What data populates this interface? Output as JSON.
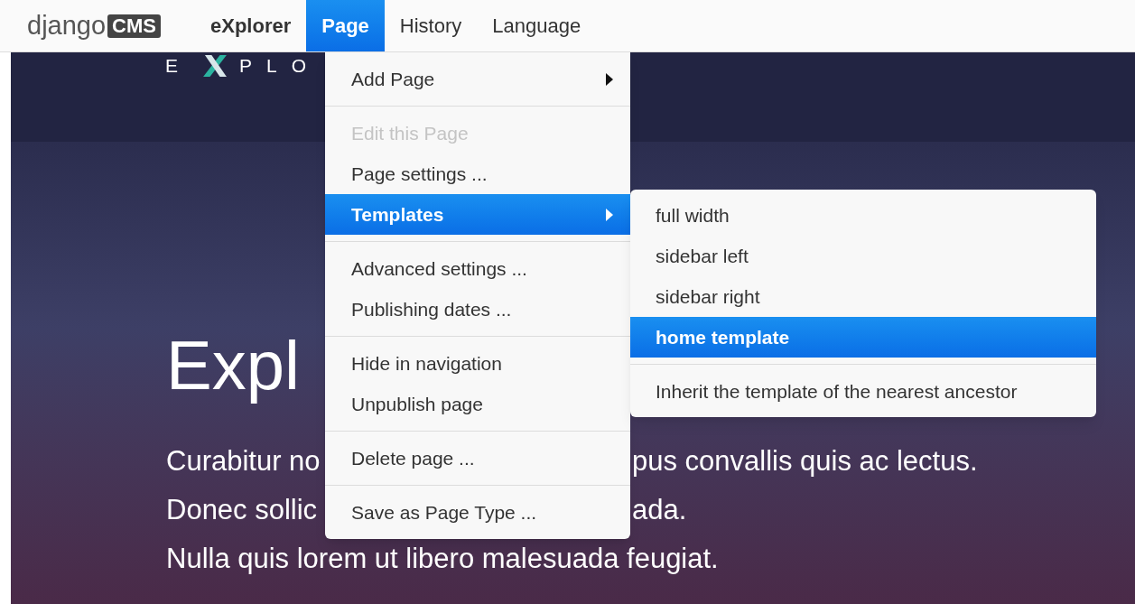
{
  "toolbar": {
    "logo": {
      "word": "django",
      "badge": "CMS"
    },
    "menus": [
      {
        "label": "eXplorer",
        "kind": "site",
        "selected": false
      },
      {
        "label": "Page",
        "kind": "menu",
        "selected": true
      },
      {
        "label": "History",
        "kind": "menu",
        "selected": false
      },
      {
        "label": "Language",
        "kind": "menu",
        "selected": false
      }
    ]
  },
  "hero": {
    "logo": {
      "before": "E",
      "after": "PLO"
    },
    "heading": "Expl",
    "lines": [
      {
        "left": "Curabitur no",
        "right": "pus convallis quis ac lectus."
      },
      {
        "left": "Donec sollic",
        "right": "ada."
      },
      {
        "left": "Nulla quis lorem ut libero malesuada feugiat."
      }
    ]
  },
  "page_menu": {
    "items": [
      {
        "kind": "item",
        "label": "Add Page",
        "submenu": true,
        "disabled": false,
        "selected": false
      },
      {
        "kind": "separator"
      },
      {
        "kind": "item",
        "label": "Edit this Page",
        "submenu": false,
        "disabled": true,
        "selected": false
      },
      {
        "kind": "item",
        "label": "Page settings ...",
        "submenu": false,
        "disabled": false,
        "selected": false
      },
      {
        "kind": "item",
        "label": "Templates",
        "submenu": true,
        "disabled": false,
        "selected": true
      },
      {
        "kind": "separator"
      },
      {
        "kind": "item",
        "label": "Advanced settings ...",
        "submenu": false,
        "disabled": false,
        "selected": false
      },
      {
        "kind": "item",
        "label": "Publishing dates ...",
        "submenu": false,
        "disabled": false,
        "selected": false
      },
      {
        "kind": "separator"
      },
      {
        "kind": "item",
        "label": "Hide in navigation",
        "submenu": false,
        "disabled": false,
        "selected": false
      },
      {
        "kind": "item",
        "label": "Unpublish page",
        "submenu": false,
        "disabled": false,
        "selected": false
      },
      {
        "kind": "separator"
      },
      {
        "kind": "item",
        "label": "Delete page ...",
        "submenu": false,
        "disabled": false,
        "selected": false
      },
      {
        "kind": "separator"
      },
      {
        "kind": "item",
        "label": "Save as Page Type ...",
        "submenu": false,
        "disabled": false,
        "selected": false
      }
    ]
  },
  "templates_menu": {
    "items": [
      {
        "kind": "item",
        "label": "full width",
        "selected": false
      },
      {
        "kind": "item",
        "label": "sidebar left",
        "selected": false
      },
      {
        "kind": "item",
        "label": "sidebar right",
        "selected": false
      },
      {
        "kind": "item",
        "label": "home template",
        "selected": true
      },
      {
        "kind": "separator"
      },
      {
        "kind": "item",
        "label": "Inherit the template of the nearest ancestor",
        "selected": false
      }
    ]
  }
}
